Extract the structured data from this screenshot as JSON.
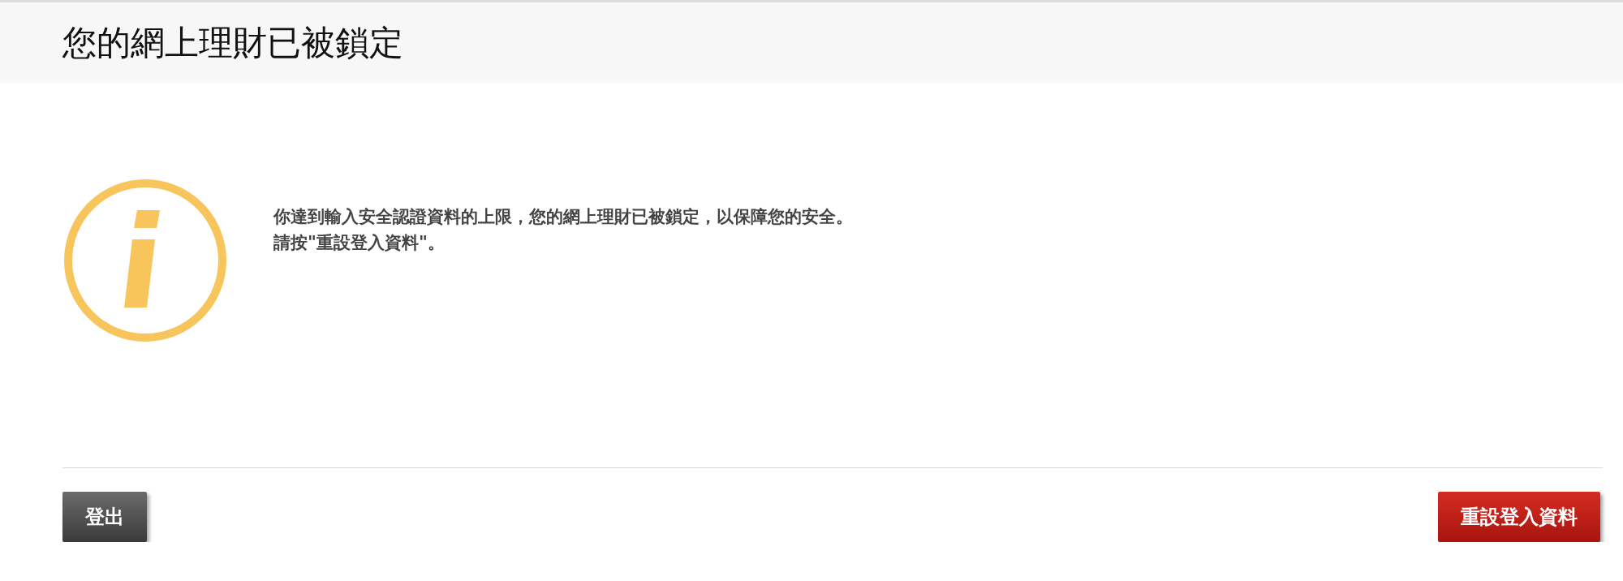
{
  "header": {
    "title": "您的網上理財已被鎖定"
  },
  "message": {
    "lines": [
      "你達到輸入安全認證資料的上限，您的網上理財已被鎖定，以保障您的安全。",
      "請按\"重設登入資料\"。"
    ]
  },
  "buttons": {
    "logout": "登出",
    "reset": "重設登入資料"
  }
}
